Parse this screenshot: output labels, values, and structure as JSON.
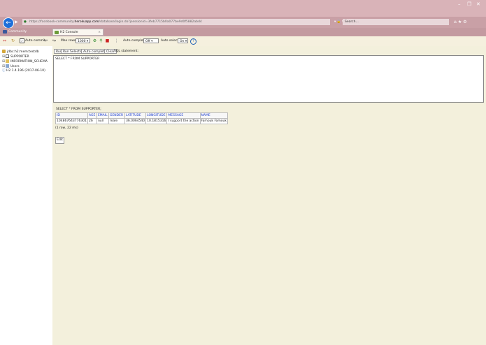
{
  "browser": {
    "address_prefix": "https://facebook-community.",
    "address_domain": "herokuapp.com",
    "address_suffix": "/database/login.do?jsessionid=3feb7715b0a077be9d0f5882abd4",
    "search_placeholder": "Search...",
    "tabs": [
      {
        "label": "Community"
      },
      {
        "label": "H2 Console"
      }
    ],
    "window_controls": [
      "–",
      "❐",
      "✕"
    ],
    "right_icons": [
      "⌂",
      "★",
      "⚙"
    ]
  },
  "toolbar": {
    "autocommit_label": "Auto commit",
    "maxrows_label": "Max rows:",
    "maxrows_value": "1000",
    "autocomplete_label": "Auto complete",
    "autocomplete_value": "Off",
    "autoselect_label": "Auto select",
    "autoselect_value": "On",
    "help_glyph": "?"
  },
  "tree": {
    "items": [
      {
        "label": "jdbc:h2:mem:testdb"
      },
      {
        "label": "SUPPORTER"
      },
      {
        "label": "INFORMATION_SCHEMA"
      },
      {
        "label": "Users"
      },
      {
        "label": "H2 1.4.196 (2017-06-10)"
      }
    ]
  },
  "query": {
    "buttons": [
      "Run",
      "Run Selected",
      "Auto complete",
      "Clear",
      "SQL statement:"
    ],
    "sql_text": "SELECT * FROM SUPPORTER"
  },
  "results": {
    "title": "SELECT * FROM SUPPORTER;",
    "columns": [
      "ID",
      "AGE",
      "EMAIL",
      "GENDER",
      "LATITUDE",
      "LONGITUDE",
      "MESSAGE",
      "NAME"
    ],
    "rows": [
      [
        "104867643776301",
        "26",
        "null",
        "male",
        "36.0064540",
        "10.1815316",
        "I support the action",
        "Famouk Famouk"
      ]
    ],
    "row_count": "(1 row, 22 ms)",
    "edit_label": "Edit"
  }
}
